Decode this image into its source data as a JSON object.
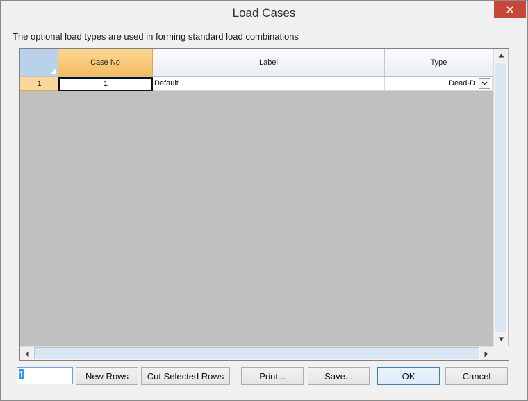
{
  "window": {
    "title": "Load Cases"
  },
  "description": "The optional load types are used in forming standard load combinations",
  "grid": {
    "columns": [
      "Case No",
      "Label",
      "Type"
    ],
    "rows": [
      {
        "row_header": "1",
        "case_no": "1",
        "label": "Default",
        "type": "Dead-D"
      }
    ]
  },
  "footer": {
    "rows_input_value": "1",
    "buttons": {
      "new_rows": "New Rows",
      "cut_selected_rows": "Cut Selected Rows",
      "print": "Print...",
      "save": "Save...",
      "ok": "OK",
      "cancel": "Cancel"
    }
  },
  "icons": {
    "close": "close-icon",
    "dropdown": "chevron-down-icon",
    "scroll_up": "arrow-up-icon",
    "scroll_down": "arrow-down-icon",
    "scroll_left": "arrow-left-icon",
    "scroll_right": "arrow-right-icon"
  },
  "colors": {
    "close_button": "#c7463a",
    "selected_header": "#f4bb62",
    "grid_background": "#c0c0c0",
    "corner_header": "#b9d1ea"
  }
}
